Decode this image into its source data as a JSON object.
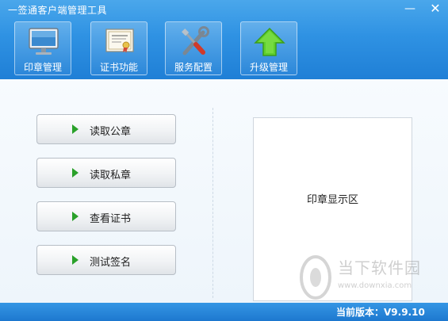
{
  "window": {
    "title": "一签通客户端管理工具",
    "min_icon": "minimize-icon",
    "close_icon": "close-icon"
  },
  "toolbar": [
    {
      "label": "印章管理",
      "icon": "monitor-icon"
    },
    {
      "label": "证书功能",
      "icon": "certificate-icon"
    },
    {
      "label": "服务配置",
      "icon": "tools-icon"
    },
    {
      "label": "升级管理",
      "icon": "upgrade-arrow-icon"
    }
  ],
  "actions": [
    {
      "label": "读取公章",
      "icon": "play-icon"
    },
    {
      "label": "读取私章",
      "icon": "play-icon"
    },
    {
      "label": "查看证书",
      "icon": "play-icon"
    },
    {
      "label": "测试签名",
      "icon": "play-icon"
    }
  ],
  "display": {
    "label": "印章显示区"
  },
  "status": {
    "version": "当前版本：V9.9.10"
  },
  "watermark": {
    "name": "当下软件园",
    "url": "www.downxia.com"
  },
  "colors": {
    "header": "#2f92e3",
    "status_bar": "#1d78cf",
    "play_green": "#2aa12a"
  }
}
